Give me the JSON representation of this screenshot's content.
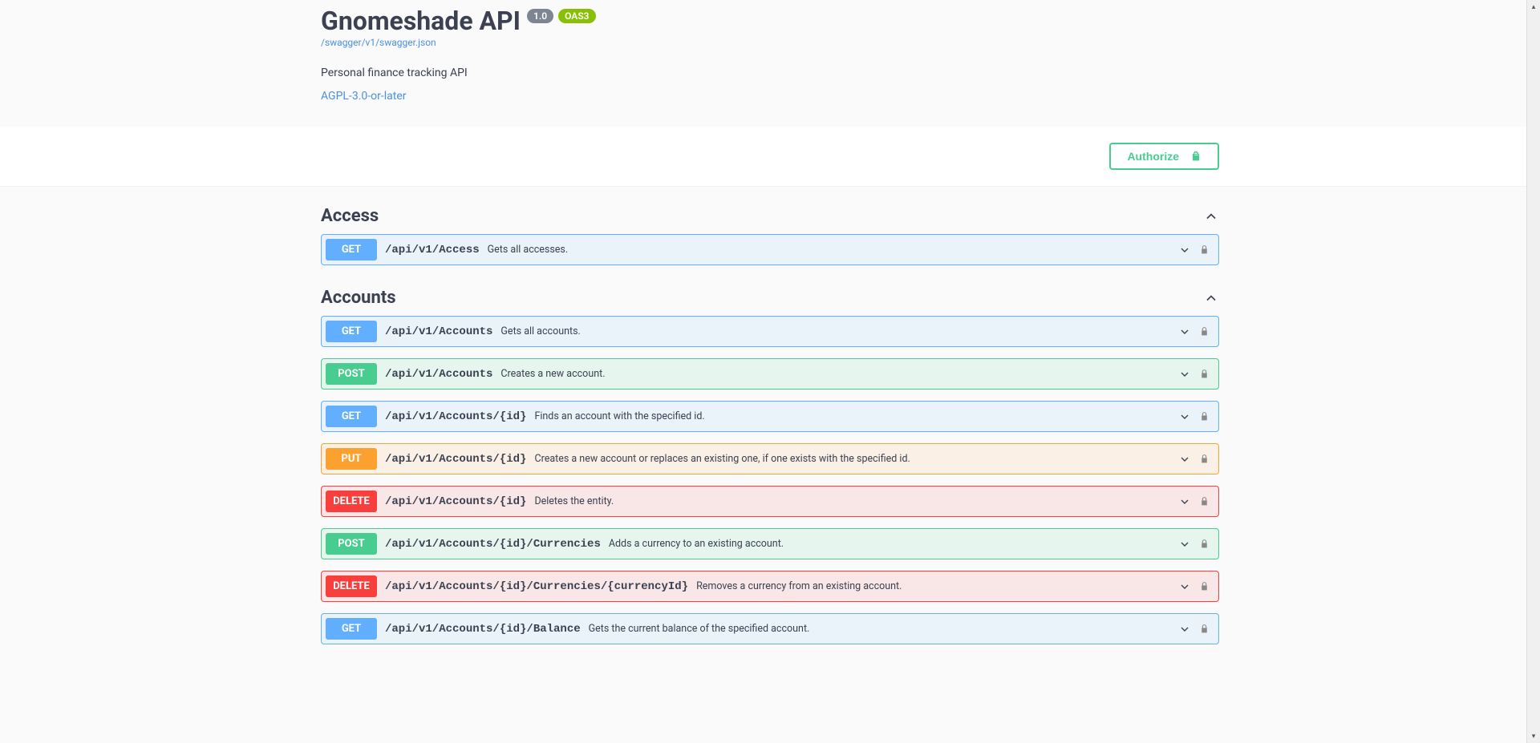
{
  "header": {
    "title": "Gnomeshade API",
    "version_badge": "1.0",
    "oas_badge": "OAS3",
    "spec_url": "/swagger/v1/swagger.json",
    "description": "Personal finance tracking API",
    "license": "AGPL-3.0-or-later"
  },
  "authorize_label": "Authorize",
  "tags": [
    {
      "name": "Access",
      "operations": [
        {
          "method": "GET",
          "path": "/api/v1/Access",
          "summary": "Gets all accesses."
        }
      ]
    },
    {
      "name": "Accounts",
      "operations": [
        {
          "method": "GET",
          "path": "/api/v1/Accounts",
          "summary": "Gets all accounts."
        },
        {
          "method": "POST",
          "path": "/api/v1/Accounts",
          "summary": "Creates a new account."
        },
        {
          "method": "GET",
          "path": "/api/v1/Accounts/{id}",
          "summary": "Finds an account with the specified id."
        },
        {
          "method": "PUT",
          "path": "/api/v1/Accounts/{id}",
          "summary": "Creates a new account or replaces an existing one, if one exists with the specified id."
        },
        {
          "method": "DELETE",
          "path": "/api/v1/Accounts/{id}",
          "summary": "Deletes the entity."
        },
        {
          "method": "POST",
          "path": "/api/v1/Accounts/{id}/Currencies",
          "summary": "Adds a currency to an existing account."
        },
        {
          "method": "DELETE",
          "path": "/api/v1/Accounts/{id}/Currencies/{currencyId}",
          "summary": "Removes a currency from an existing account."
        },
        {
          "method": "GET",
          "path": "/api/v1/Accounts/{id}/Balance",
          "summary": "Gets the current balance of the specified account."
        }
      ]
    }
  ]
}
